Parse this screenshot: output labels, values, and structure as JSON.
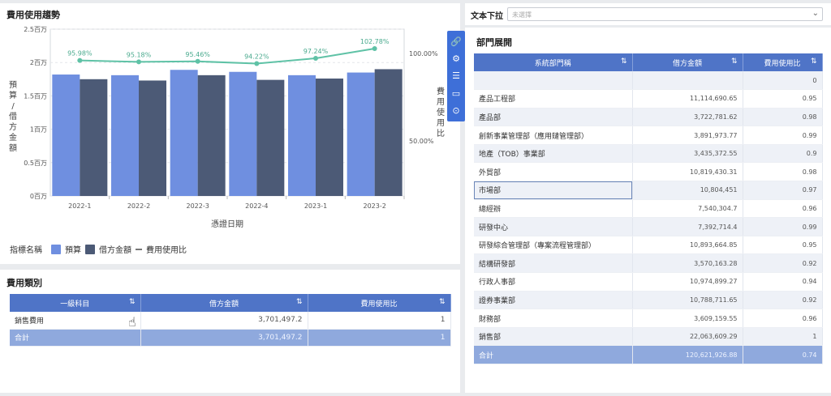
{
  "chart_panel": {
    "title": "費用使用趨勢",
    "legend": {
      "label": "指標名稱",
      "items": [
        "預算",
        "借方金額",
        "費用使用比"
      ]
    }
  },
  "chart_data": {
    "type": "bar",
    "categories": [
      "2022-1",
      "2022-2",
      "2022-3",
      "2022-4",
      "2023-1",
      "2023-2"
    ],
    "series": [
      {
        "name": "預算",
        "values": [
          1.82,
          1.81,
          1.89,
          1.86,
          1.81,
          1.85
        ],
        "color": "#6f8fe0"
      },
      {
        "name": "借方金額",
        "values": [
          1.75,
          1.73,
          1.81,
          1.74,
          1.76,
          1.9
        ],
        "color": "#4c5a76"
      },
      {
        "name": "費用使用比",
        "values": [
          95.98,
          95.18,
          95.46,
          94.22,
          97.24,
          102.78
        ],
        "labels": [
          "95.98%",
          "95.18%",
          "95.46%",
          "94.22%",
          "97.24%",
          "102.78%"
        ],
        "color": "#5fc2a6"
      }
    ],
    "xlabel": "憑證日期",
    "ylabel": "預算/借方金額",
    "y2label": "費用使用比",
    "yticks": [
      "0百万",
      "0.5百万",
      "1百万",
      "1.5百万",
      "2百万",
      "2.5百万"
    ],
    "ylim": [
      0,
      2.5
    ],
    "y2ticks": [
      "50.00%",
      "100.00%"
    ],
    "legend_position": "bottom-left"
  },
  "toolbar": {
    "icons": [
      "link-icon",
      "settings-gear-icon",
      "columns-icon",
      "comment-icon",
      "collapse-icon"
    ]
  },
  "category_panel": {
    "title": "費用類別",
    "headers": [
      "一級科目",
      "借方金額",
      "費用使用比"
    ],
    "rows": [
      {
        "cat": "銷售費用",
        "amount": "3,701,497.2",
        "ratio": "1"
      }
    ],
    "total": {
      "cat": "合計",
      "amount": "3,701,497.2",
      "ratio": "1"
    }
  },
  "dropdown": {
    "label": "文本下拉",
    "placeholder": "未選擇"
  },
  "dept_panel": {
    "title": "部門展開",
    "headers": [
      "系統部門稱",
      "借方金額",
      "費用使用比"
    ],
    "rows": [
      {
        "name": "",
        "amount": "",
        "ratio": "0"
      },
      {
        "name": "產品工程部",
        "amount": "11,114,690.65",
        "ratio": "0.95"
      },
      {
        "name": "產品部",
        "amount": "3,722,781.62",
        "ratio": "0.98"
      },
      {
        "name": "創新事業管理部（應用鏈管理部）",
        "amount": "3,891,973.77",
        "ratio": "0.99"
      },
      {
        "name": "地產（TOB）事業部",
        "amount": "3,435,372.55",
        "ratio": "0.9"
      },
      {
        "name": "外貿部",
        "amount": "10,819,430.31",
        "ratio": "0.98"
      },
      {
        "name": "市場部",
        "amount": "10,804,451",
        "ratio": "0.97"
      },
      {
        "name": "總經辦",
        "amount": "7,540,304.7",
        "ratio": "0.96"
      },
      {
        "name": "研發中心",
        "amount": "7,392,714.4",
        "ratio": "0.99"
      },
      {
        "name": "研發綜合管理部（專案流程管理部）",
        "amount": "10,893,664.85",
        "ratio": "0.95"
      },
      {
        "name": "結構研發部",
        "amount": "3,570,163.28",
        "ratio": "0.92"
      },
      {
        "name": "行政人事部",
        "amount": "10,974,899.27",
        "ratio": "0.94"
      },
      {
        "name": "證券事業部",
        "amount": "10,788,711.65",
        "ratio": "0.92"
      },
      {
        "name": "財務部",
        "amount": "3,609,159.55",
        "ratio": "0.96"
      },
      {
        "name": "銷售部",
        "amount": "22,063,609.29",
        "ratio": "1"
      }
    ],
    "total": {
      "name": "合計",
      "amount": "120,621,926.88",
      "ratio": "0.74"
    }
  }
}
